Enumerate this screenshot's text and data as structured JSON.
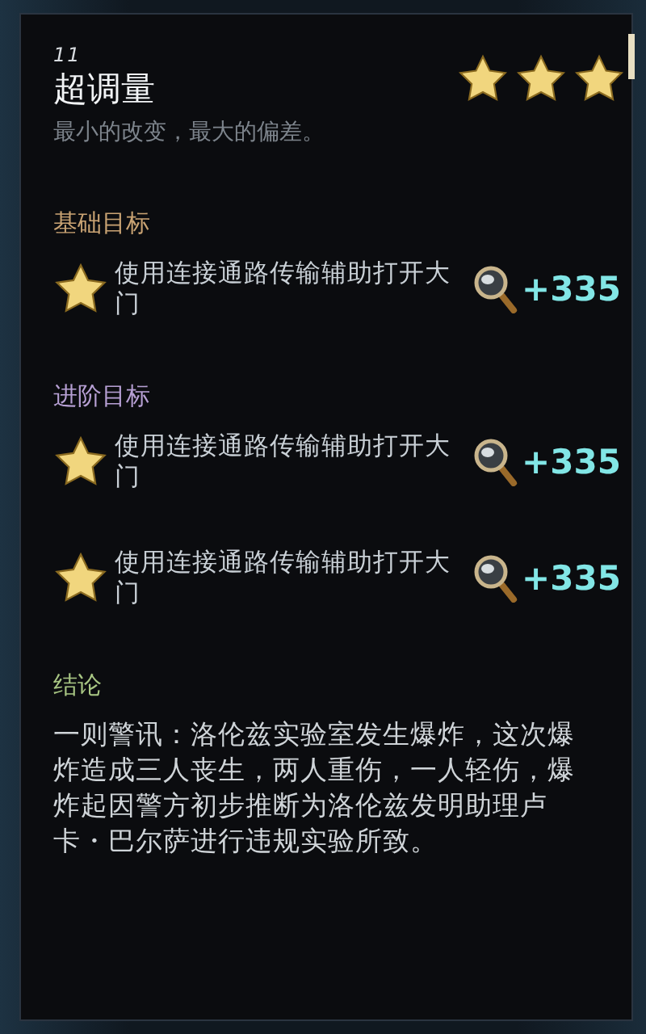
{
  "header": {
    "number": "11",
    "title": "超调量",
    "subtitle": "最小的改变，最大的偏差。",
    "stars": 3
  },
  "sections": [
    {
      "kind": "goals",
      "title": "基础目标",
      "color": "#c9a373",
      "goals": [
        {
          "text": "使用连接通路传输辅助打开大门",
          "reward": "+335"
        }
      ]
    },
    {
      "kind": "goals",
      "title": "进阶目标",
      "color": "#b7a0d4",
      "goals": [
        {
          "text": "使用连接通路传输辅助打开大门",
          "reward": "+335"
        },
        {
          "text": "使用连接通路传输辅助打开大门",
          "reward": "+335"
        }
      ]
    },
    {
      "kind": "text",
      "title": "结论",
      "color": "#a9c784",
      "body": "一则警讯：洛伦兹实验室发生爆炸，这次爆炸造成三人丧生，两人重伤，一人轻伤，爆炸起因警方初步推断为洛伦兹发明助理卢卡・巴尔萨进行违规实验所致。"
    }
  ]
}
